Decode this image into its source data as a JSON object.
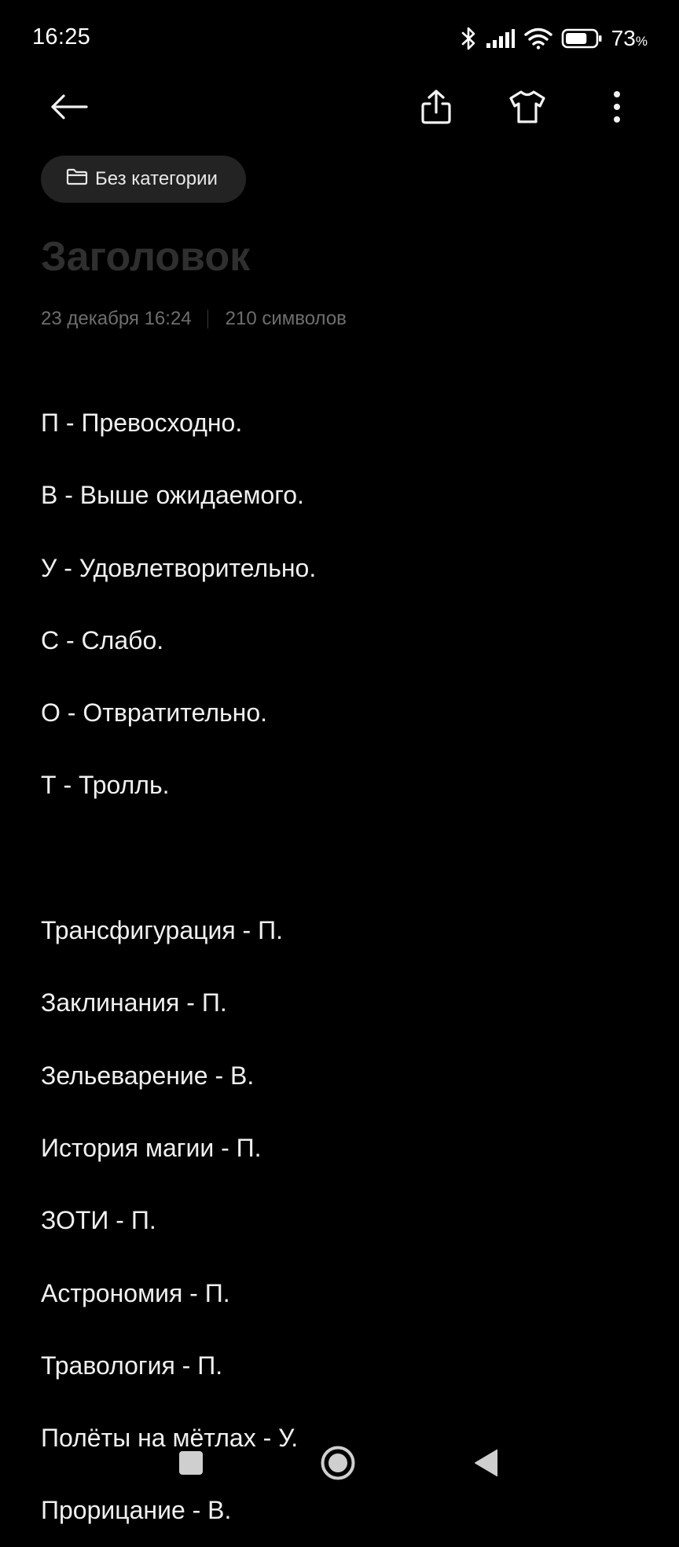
{
  "status_bar": {
    "time": "16:25",
    "battery_percent": "73",
    "battery_symbol": "%",
    "battery_level": 0.73,
    "icons": [
      "bluetooth-icon",
      "signal-icon",
      "wifi-icon",
      "battery-icon"
    ]
  },
  "toolbar": {
    "icons": [
      "back-arrow-icon",
      "share-icon",
      "theme-shirt-icon",
      "more-vertical-icon"
    ]
  },
  "category": {
    "icon": "folder-icon",
    "label": "Без категории"
  },
  "note": {
    "title_placeholder": "Заголовок",
    "title_value": "",
    "date": "23 декабря 16:24",
    "char_count": "210 символов",
    "lines": [
      "П - Превосходно.",
      "В - Выше ожидаемого.",
      "У - Удовлетворительно.",
      "С - Слабо.",
      "О - Отвратительно.",
      "Т - Тролль.",
      "",
      "Трансфигурация - П.",
      "Заклинания - П.",
      "Зельеварение - В.",
      "История магии - П.",
      "ЗОТИ - П.",
      "Астрономия - П.",
      "Травология - П.",
      "Полёты на мётлах - У.",
      "Прорицание - В."
    ]
  },
  "nav_bar": {
    "icons": [
      "recents-square-icon",
      "home-circle-icon",
      "back-triangle-icon"
    ]
  },
  "colors": {
    "background": "#000000",
    "text": "#f0f0f0",
    "chip_background": "#232323",
    "meta_text": "#6e6e6e",
    "placeholder": "#2f2f2f"
  }
}
